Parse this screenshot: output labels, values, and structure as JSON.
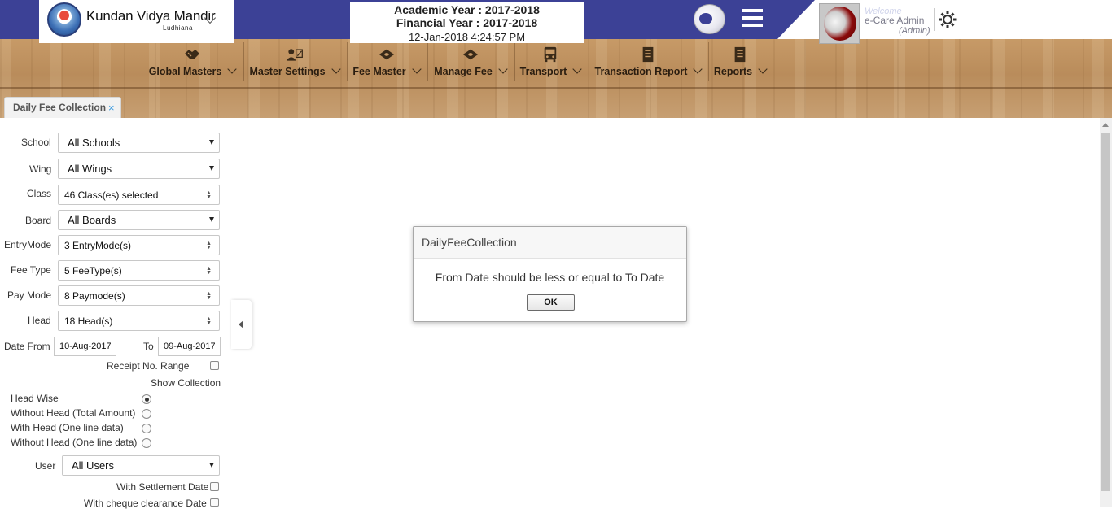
{
  "header": {
    "school_name": "Kundan Vidya Mandir",
    "school_city": "Ludhiana",
    "academic_year": "Academic Year : 2017-2018",
    "financial_year": "Financial Year : 2017-2018",
    "datetime": "12-Jan-2018 4:24:57 PM",
    "welcome": "Welcome",
    "user_name": "e-Care Admin",
    "user_role": "(Admin)",
    "colors": {
      "primary": "#3c4196",
      "wood": "#bf9263",
      "accent": "#3c9be0"
    }
  },
  "nav": {
    "items": [
      {
        "label": "Global Masters",
        "icon": "handshake-icon"
      },
      {
        "label": "Master Settings",
        "icon": "user-edit-icon"
      },
      {
        "label": "Fee Master",
        "icon": "money-icon"
      },
      {
        "label": "Manage Fee",
        "icon": "money-icon"
      },
      {
        "label": "Transport",
        "icon": "bus-icon"
      },
      {
        "label": "Transaction Report",
        "icon": "report-icon"
      },
      {
        "label": "Reports",
        "icon": "report-icon"
      }
    ]
  },
  "tab": {
    "label": "Daily Fee Collection",
    "close": "×"
  },
  "form": {
    "school": {
      "label": "School",
      "value": "All Schools"
    },
    "wing": {
      "label": "Wing",
      "value": "All Wings"
    },
    "class": {
      "label": "Class",
      "value": "46 Class(es) selected"
    },
    "board": {
      "label": "Board",
      "value": "All Boards"
    },
    "entry_mode": {
      "label": "EntryMode",
      "value": "3 EntryMode(s)"
    },
    "fee_type": {
      "label": "Fee Type",
      "value": "5 FeeType(s)"
    },
    "pay_mode": {
      "label": "Pay Mode",
      "value": "8 Paymode(s)"
    },
    "head": {
      "label": "Head",
      "value": "18 Head(s)"
    },
    "date_from": {
      "label": "Date From",
      "value": "10-Aug-2017"
    },
    "date_to": {
      "label": "To",
      "value": "09-Aug-2017"
    },
    "receipt_range": {
      "label": "Receipt No. Range",
      "checked": false
    },
    "show_collection": {
      "label": "Show Collection"
    },
    "collection_options": [
      {
        "label": "Head Wise",
        "checked": true
      },
      {
        "label": "Without Head (Total Amount)",
        "checked": false
      },
      {
        "label": "With Head (One line data)",
        "checked": false
      },
      {
        "label": "Without Head (One line data)",
        "checked": false
      }
    ],
    "user": {
      "label": "User",
      "value": "All Users"
    },
    "settlement_date": {
      "label": "With Settlement Date",
      "checked": false
    },
    "cheque_date": {
      "label": "With cheque clearance Date",
      "checked": false
    }
  },
  "dialog": {
    "title": "DailyFeeCollection",
    "message": "From Date should be less or equal to To Date",
    "ok_label": "OK"
  }
}
